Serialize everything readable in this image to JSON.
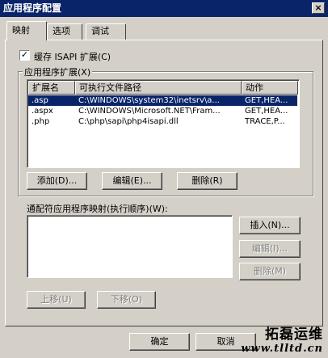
{
  "window": {
    "title": "应用程序配置",
    "close": "×"
  },
  "tabs": [
    "映射",
    "选项",
    "调试"
  ],
  "cache": {
    "label": "缓存 ISAPI 扩展(C)",
    "checked": "✓"
  },
  "extensions": {
    "group_label": "应用程序扩展(X)",
    "columns": [
      "扩展名",
      "可执行文件路径",
      "动作"
    ],
    "rows": [
      {
        "ext": ".asp",
        "path": "C:\\WINDOWS\\system32\\inetsrv\\a...",
        "verbs": "GET,HEA..."
      },
      {
        "ext": ".aspx",
        "path": "C:\\WINDOWS\\Microsoft.NET\\Fram...",
        "verbs": "GET,HEA..."
      },
      {
        "ext": ".php",
        "path": "C:\\php\\sapi\\php4isapi.dll",
        "verbs": "TRACE,P..."
      }
    ],
    "add": "添加(D)...",
    "edit": "编辑(E)...",
    "delete": "删除(R)"
  },
  "wildcard": {
    "label": "通配符应用程序映射(执行顺序)(W):",
    "insert": "插入(N)...",
    "edit": "编辑(I)...",
    "delete": "删除(M)",
    "up": "上移(U)",
    "down": "下移(O)"
  },
  "footer": {
    "ok": "确定",
    "cancel": "取消"
  },
  "watermark": {
    "text": "拓磊运维",
    "url": "www.tlltd.cn"
  }
}
